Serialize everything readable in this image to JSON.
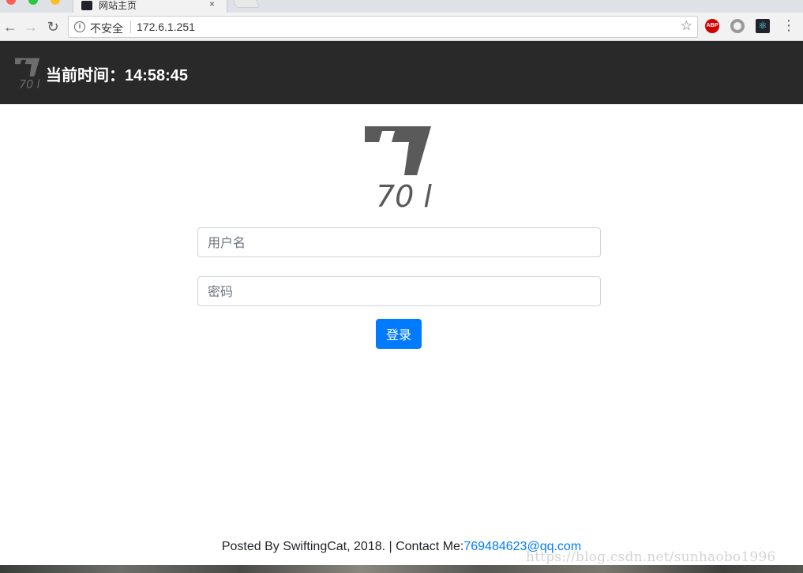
{
  "browser": {
    "tab": {
      "title": "网站主页",
      "close_glyph": "×"
    },
    "nav": {
      "back": "←",
      "forward": "→",
      "reload": "↻"
    },
    "omnibox": {
      "info_glyph": "i",
      "security_label": "不安全",
      "url": "172.6.1.251",
      "bookmark_glyph": "☆"
    },
    "extensions": {
      "abp_label": "ABP",
      "react_glyph": "⚛"
    },
    "menu_glyph": "⋮"
  },
  "header": {
    "clock_text": "当前时间：14:58:45"
  },
  "logo": {
    "caption": "70 l"
  },
  "login": {
    "username_placeholder": "用户名",
    "password_placeholder": "密码",
    "submit_label": "登录"
  },
  "footer": {
    "posted_by": "Posted By SwiftingCat, 2018.  |  Contact Me:",
    "email": "769484623@qq.com"
  },
  "watermark": "https://blog.csdn.net/sunhaobo1996",
  "colors": {
    "header_bg": "#292929",
    "primary": "#007bff",
    "logo_gray": "#5a5a5a"
  }
}
